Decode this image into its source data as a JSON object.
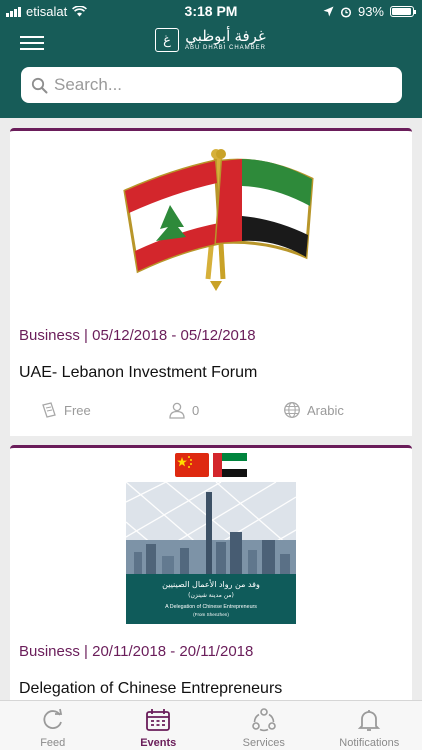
{
  "status_bar": {
    "carrier": "etisalat",
    "time": "3:18 PM",
    "battery": "93%",
    "battery_level": 0.93
  },
  "header": {
    "logo_arabic": "غرفة أبوظبي",
    "logo_english": "ABU DHABI CHAMBER",
    "logo_mark": "ﻍ"
  },
  "search": {
    "placeholder": "Search..."
  },
  "events": [
    {
      "category_dates": "Business | 05/12/2018 - 05/12/2018",
      "title": "UAE- Lebanon Investment Forum",
      "price": "Free",
      "attendees": "0",
      "language": "Arabic"
    },
    {
      "category_dates": "Business | 20/11/2018 - 20/11/2018",
      "title": "Delegation of Chinese Entrepreneurs",
      "poster_arabic": "وفد من رواد الأعمال الصينيين",
      "poster_arabic_sub": "(من مدينة شينزن)",
      "poster_english": "A Delegation of Chinese Entrepreneurs",
      "poster_english_sub": "(From Shenzhen)"
    }
  ],
  "tabs": [
    {
      "label": "Feed",
      "icon": "refresh-icon"
    },
    {
      "label": "Events",
      "icon": "calendar-icon"
    },
    {
      "label": "Services",
      "icon": "services-cycle-icon"
    },
    {
      "label": "Notifications",
      "icon": "bell-icon"
    }
  ],
  "colors": {
    "header": "#175c58",
    "accent": "#6a1d5a",
    "background": "#ececec"
  }
}
